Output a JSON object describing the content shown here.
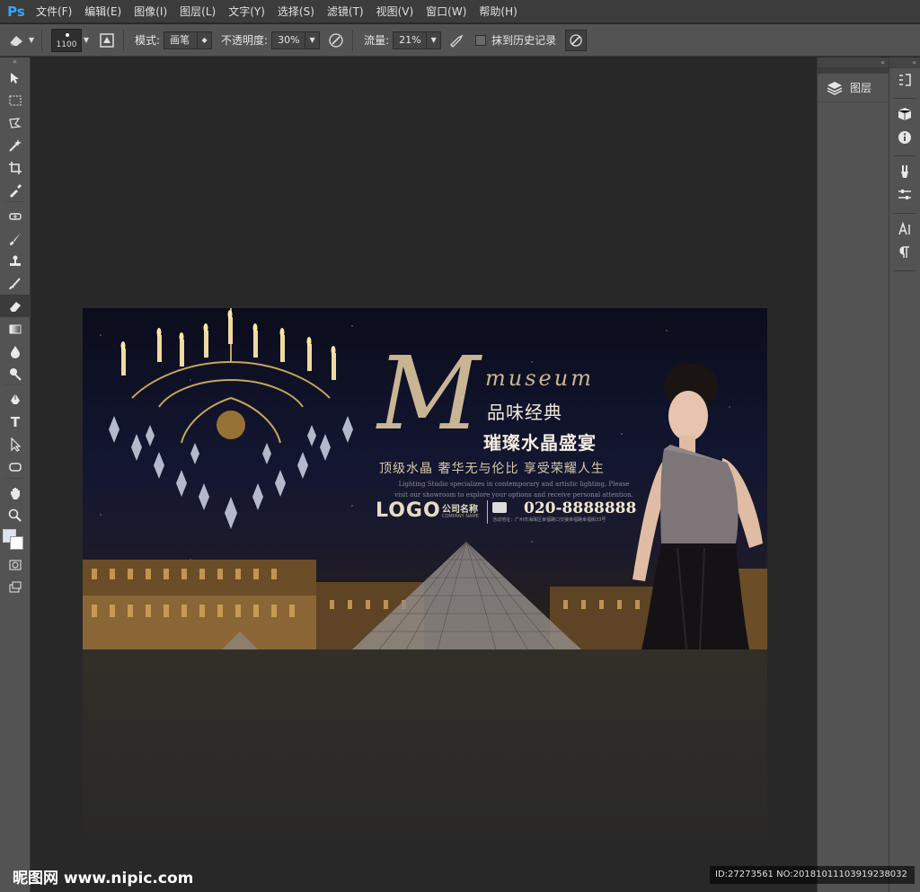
{
  "app": {
    "logo": "Ps"
  },
  "menu": [
    "文件(F)",
    "编辑(E)",
    "图像(I)",
    "图层(L)",
    "文字(Y)",
    "选择(S)",
    "滤镜(T)",
    "视图(V)",
    "窗口(W)",
    "帮助(H)"
  ],
  "options": {
    "brush_size": "1100",
    "mode_label": "模式:",
    "mode_value": "画笔",
    "opacity_label": "不透明度:",
    "opacity_value": "30%",
    "flow_label": "流量:",
    "flow_value": "21%",
    "erase_history_label": "抹到历史记录",
    "erase_history_checked": false
  },
  "panels": {
    "layers_label": "图层"
  },
  "document": {
    "big_letter": "M",
    "museum": "museum",
    "title1": "品味经典",
    "title2": "璀璨水晶盛宴",
    "slogan": "顶级水晶  奢华无与伦比  享受荣耀人生",
    "english_line1": "Lighting Studio specializes in contemporary and artistic lighting. Please",
    "english_line2": "visit our showroom to explore your options and receive personal attention.",
    "logo": "LOGO",
    "company": "公司名称",
    "company_en": "COMPANY NAME",
    "phone": "020-8888888",
    "address": "活动地址：广州市海珠区幸福路口交接幸福路幸福街33号"
  },
  "watermark": {
    "left": "昵图网 www.nipic.com",
    "right": "ID:27273561 NO:20181011103919238032"
  },
  "colors": {
    "accent_gold": "#c9b594",
    "ps_blue": "#31a8ff"
  }
}
